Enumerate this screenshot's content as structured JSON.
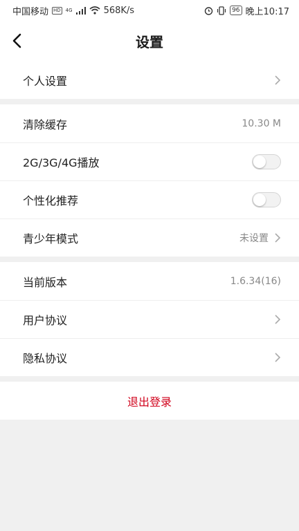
{
  "status_bar": {
    "carrier": "中国移动",
    "hd": "HD",
    "signal": "4G",
    "speed": "568K/s",
    "battery": "96",
    "time": "晚上10:17"
  },
  "header": {
    "title": "设置",
    "back_icon": "chevron-left-icon"
  },
  "groups": [
    {
      "items": [
        {
          "label": "个人设置",
          "value": "",
          "control": "chevron"
        }
      ]
    },
    {
      "items": [
        {
          "label": "清除缓存",
          "value": "10.30 M",
          "control": "none"
        },
        {
          "label": "2G/3G/4G播放",
          "value": "",
          "control": "toggle",
          "toggle_on": false
        },
        {
          "label": "个性化推荐",
          "value": "",
          "control": "toggle",
          "toggle_on": false
        },
        {
          "label": "青少年模式",
          "value": "未设置",
          "control": "chevron"
        }
      ]
    },
    {
      "items": [
        {
          "label": "当前版本",
          "value": "1.6.34(16)",
          "control": "none"
        },
        {
          "label": "用户协议",
          "value": "",
          "control": "chevron"
        },
        {
          "label": "隐私协议",
          "value": "",
          "control": "chevron"
        }
      ]
    }
  ],
  "logout": {
    "label": "退出登录",
    "color": "#d0021b"
  },
  "colors": {
    "background": "#f0f0f0",
    "card": "#ffffff",
    "accent": "#d0021b"
  }
}
